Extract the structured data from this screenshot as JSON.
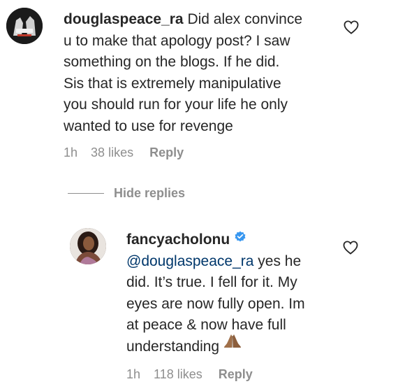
{
  "comments": [
    {
      "username": "douglaspeace_ra",
      "lines": [
        "Did alex convince",
        "u to make that apology post? I saw",
        "something on the blogs. If he did.",
        "Sis that is extremely manipulative",
        "you should run for your life he only",
        "wanted to use for revenge"
      ],
      "time": "1h",
      "likes": "38 likes",
      "reply_label": "Reply",
      "avatar_icon": "avatar",
      "like_icon": "heart-outline-icon"
    },
    {
      "username": "fancyacholonu",
      "verified": true,
      "mention": "@douglaspeace_ra",
      "lines": [
        "yes he",
        "did. It’s true. I fell for it. My",
        "eyes are now fully open. Im",
        "at peace & now have full",
        "understanding"
      ],
      "emoji": "folded-hands",
      "time": "1h",
      "likes": "118 likes",
      "reply_label": "Reply",
      "avatar_icon": "avatar",
      "like_icon": "heart-outline-icon"
    }
  ],
  "hide_replies_label": "Hide replies",
  "colors": {
    "text": "#262626",
    "meta": "#8e8e8e",
    "mention": "#00376b",
    "verified": "#3897f0"
  }
}
